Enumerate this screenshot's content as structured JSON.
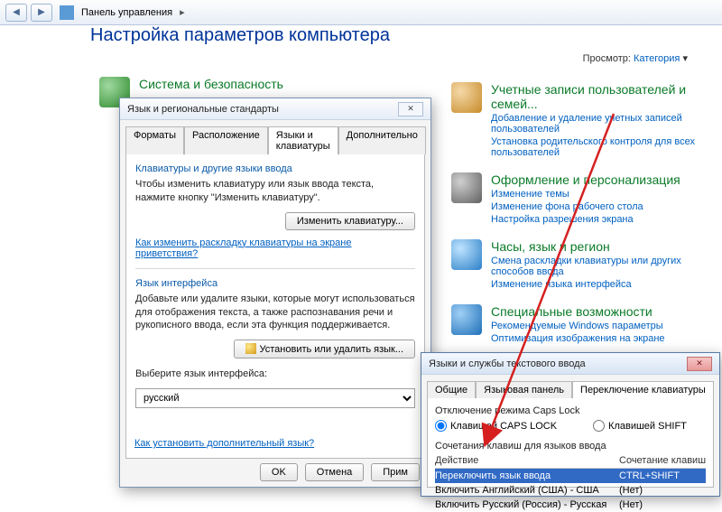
{
  "navbar": {
    "back_glyph": "◀",
    "fwd_glyph": "▶",
    "breadcrumb": "Панель управления",
    "sep": "▸"
  },
  "page": {
    "title": "Настройка параметров компьютера",
    "view_label": "Просмотр:",
    "view_value": "Категория"
  },
  "left_category": {
    "title": "Система и безопасность"
  },
  "right_categories": [
    {
      "title": "Учетные записи пользователей и семей...",
      "links": [
        "Добавление и удаление учетных записей пользователей",
        "Установка родительского контроля для всех пользователей"
      ]
    },
    {
      "title": "Оформление и персонализация",
      "links": [
        "Изменение темы",
        "Изменение фона рабочего стола",
        "Настройка разрешения экрана"
      ]
    },
    {
      "title": "Часы, язык и регион",
      "links": [
        "Смена раскладки клавиатуры или других способов ввода",
        "Изменение языка интерфейса"
      ]
    },
    {
      "title": "Специальные возможности",
      "links": [
        "Рекомендуемые Windows параметры",
        "Оптимизация изображения на экране"
      ]
    }
  ],
  "dlg1": {
    "title": "Язык и региональные стандарты",
    "close": "✕",
    "tabs": [
      "Форматы",
      "Расположение",
      "Языки и клавиатуры",
      "Дополнительно"
    ],
    "active_tab": 2,
    "group1_title": "Клавиатуры и другие языки ввода",
    "group1_text": "Чтобы изменить клавиатуру или язык ввода текста, нажмите кнопку \"Изменить клавиатуру\".",
    "btn_change_kbd": "Изменить клавиатуру...",
    "link_welcome": "Как изменить раскладку клавиатуры на экране приветствия?",
    "group2_title": "Язык интерфейса",
    "group2_text": "Добавьте или удалите языки, которые могут использоваться для отображения текста, а также распознавания речи и рукописного ввода, если эта функция поддерживается.",
    "btn_install": "Установить или удалить язык...",
    "select_label": "Выберите язык интерфейса:",
    "select_value": "русский",
    "link_extra": "Как установить дополнительный язык?",
    "btn_ok": "OK",
    "btn_cancel": "Отмена",
    "btn_apply": "Прим"
  },
  "dlg2": {
    "title": "Языки и службы текстового ввода",
    "close": "✕",
    "tabs": [
      "Общие",
      "Языковая панель",
      "Переключение клавиатуры"
    ],
    "active_tab": 2,
    "caps_title": "Отключение режима Caps Lock",
    "radio_caps": "Клавишей CAPS LOCK",
    "radio_shift": "Клавишей SHIFT",
    "combo_title": "Сочетания клавиш для языков ввода",
    "col_action": "Действие",
    "col_shortcut": "Сочетание клавиш",
    "rows": [
      {
        "action": "Переключить язык ввода",
        "shortcut": "CTRL+SHIFT",
        "selected": true
      },
      {
        "action": "Включить Английский (США) - США",
        "shortcut": "(Нет)",
        "selected": false
      },
      {
        "action": "Включить Русский (Россия) - Русская",
        "shortcut": "(Нет)",
        "selected": false
      }
    ]
  }
}
